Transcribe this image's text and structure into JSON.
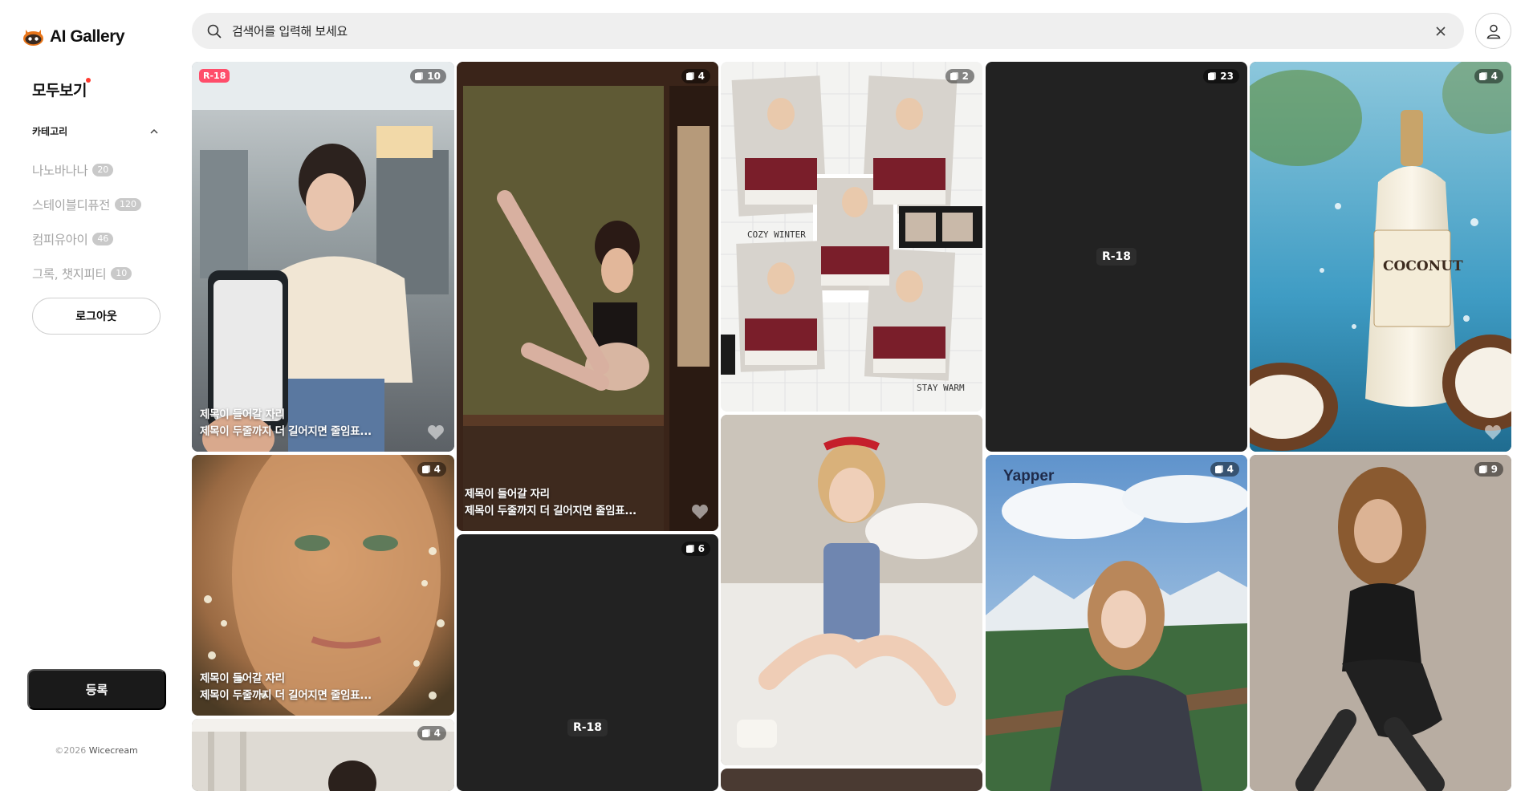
{
  "app": {
    "logo_text": "AI Gallery"
  },
  "sidebar": {
    "all_view": "모두보기",
    "category_title": "카테고리",
    "categories": [
      {
        "label": "나노바나나",
        "count": "20"
      },
      {
        "label": "스테이블디퓨전",
        "count": "120"
      },
      {
        "label": "컴피유아이",
        "count": "46"
      },
      {
        "label": "그록, 챗지피티",
        "count": "10"
      }
    ],
    "logout_label": "로그아웃",
    "register_label": "등록",
    "copyright_prefix": "©2026",
    "copyright_brand": "Wicecream"
  },
  "search": {
    "placeholder": "검색어를 입력해 보세요"
  },
  "cards": [
    {
      "count": "10",
      "rated": "R-18",
      "caption_1": "제목이 들어갈 자리",
      "caption_2": "제목이 두줄까지 더 길어지면 줄임표..."
    },
    {
      "count": "4",
      "caption_1": "제목이 들어갈 자리",
      "caption_2": "제목이 두줄까지 더 길어지면 줄임표..."
    },
    {
      "count": "2"
    },
    {
      "count": "23",
      "center_label": "R-18"
    },
    {
      "count": "4"
    },
    {
      "count": "4",
      "caption_1": "제목이 들어갈 자리",
      "caption_2": "제목이 두줄까지 더 길어지면 줄임표..."
    },
    {
      "count": "6",
      "center_label": "R-18"
    },
    {
      "count": "4",
      "brand": "Yapper"
    },
    {
      "count": "9"
    },
    {
      "count": "4"
    }
  ],
  "image_texts": {
    "cozy": "COZY WINTER",
    "warm": "STAY WARM",
    "coconut": "COCONUT"
  },
  "colors": {
    "accent_red": "#ff3b30",
    "rated_badge": "#ff4d6a",
    "dark_button": "#1a1a1a"
  }
}
